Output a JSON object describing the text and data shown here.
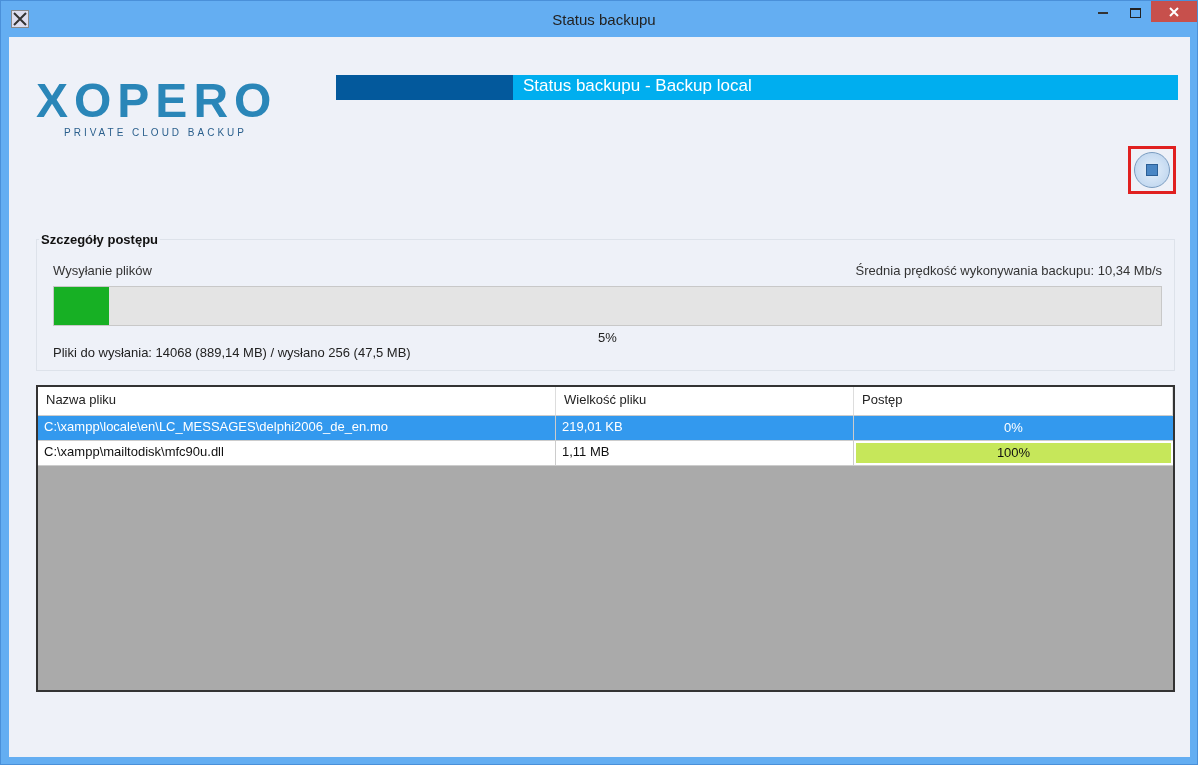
{
  "window": {
    "title": "Status backupu"
  },
  "logo": {
    "name": "XOPERO",
    "tagline": "PRIVATE CLOUD BACKUP"
  },
  "header": {
    "title": "Status backupu - Backup local"
  },
  "stop_button": {
    "highlighted": true
  },
  "progress": {
    "group_title": "Szczegóły postępu",
    "stage": "Wysyłanie plików",
    "speed": "Średnia prędkość wykonywania backupu: 10,34 Mb/s",
    "level": 0.05,
    "percent": "5%",
    "summary": "Pliki do wysłania: 14068 (889,14 MB) / wysłano 256 (47,5 MB)"
  },
  "table": {
    "columns": [
      "Nazwa pliku",
      "Wielkość pliku",
      "Postęp"
    ],
    "rows": [
      {
        "name": "C:\\xampp\\locale\\en\\LC_MESSAGES\\delphi2006_de_en.mo",
        "size": "219,01 KB",
        "percent": "0%",
        "selected": true
      },
      {
        "name": "C:\\xampp\\mailtodisk\\mfc90u.dll",
        "size": "1,11 MB",
        "level": 1,
        "percent": "100%",
        "selected": false
      }
    ]
  }
}
